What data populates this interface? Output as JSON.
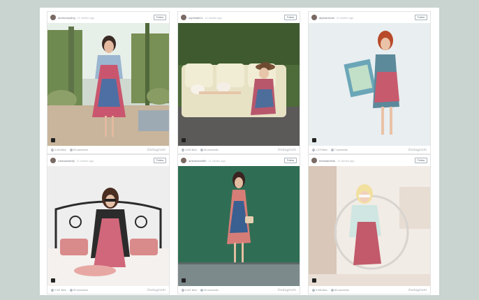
{
  "cards": [
    {
      "user": "anniecoupling",
      "time": "11 weeks ago",
      "follow": "Follow",
      "likes": "3,443 likes",
      "comments": "63 comments",
      "brand": "Instagram"
    },
    {
      "user": "sophiadev1",
      "time": "11 weeks ago",
      "follow": "Follow",
      "likes": "3,630 likes",
      "comments": "46 comments",
      "brand": "Instagram"
    },
    {
      "user": "alyssanicole",
      "time": "11 weeks ago",
      "follow": "Follow",
      "likes": "1,379 likes",
      "comments": "7 comments",
      "brand": "Instagram"
    },
    {
      "user": "rosewanderly",
      "time": "11 weeks ago",
      "follow": "Follow",
      "likes": "2,321 likes",
      "comments": "59 comments",
      "brand": "Instagram"
    },
    {
      "user": "amerimeredith",
      "time": "11 weeks ago",
      "follow": "Follow",
      "likes": "6,697 likes",
      "comments": "26 comments",
      "brand": "Instagram"
    },
    {
      "user": "thestateofme",
      "time": "11 weeks ago",
      "follow": "Follow",
      "likes": "5,966 likes",
      "comments": "56 comments",
      "brand": "Instagram"
    }
  ],
  "icons": {
    "camera": "camera-icon",
    "heart": "heart-icon",
    "comment": "comment-icon"
  }
}
